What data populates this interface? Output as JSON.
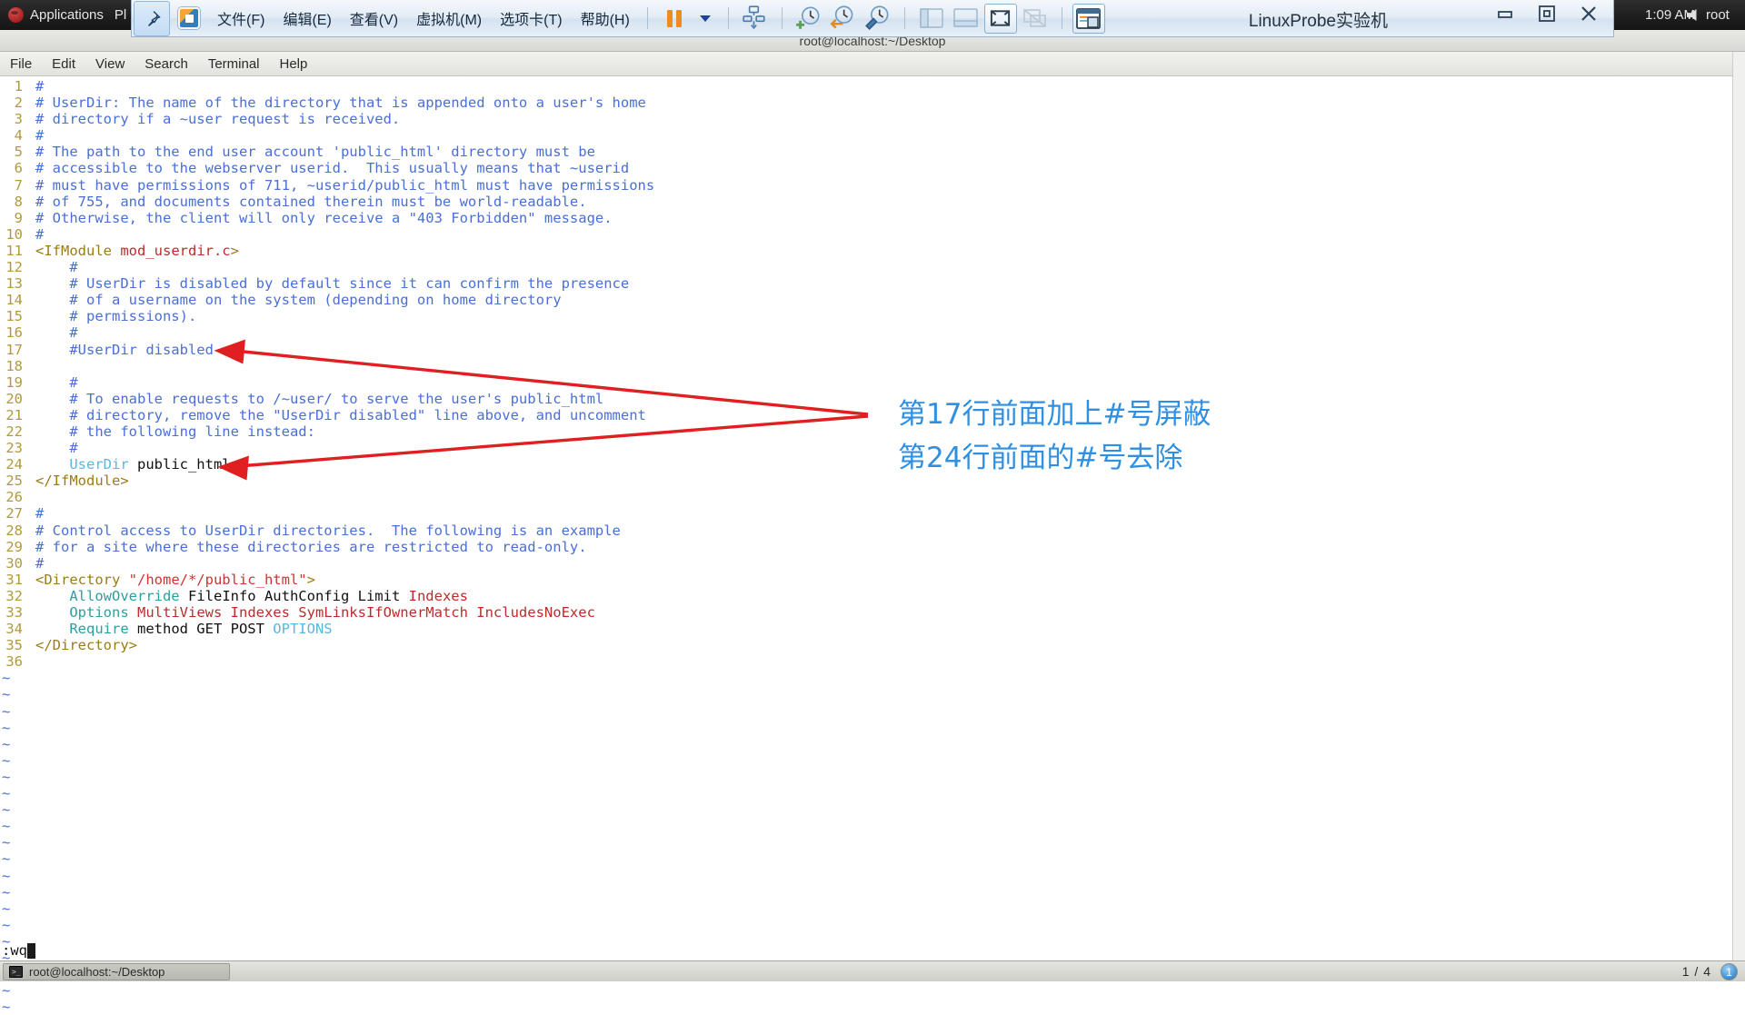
{
  "desktop_panel": {
    "applications_label": "Applications",
    "places_label": "Pl",
    "clock": "1:09 AM",
    "user": "root",
    "logo_icon": "fedora-logo-icon",
    "sound_icon": "speaker-icon"
  },
  "vmware": {
    "pin_icon": "pin-icon",
    "app_icon": "vmware-app-icon",
    "menus": [
      {
        "label": "文件(F)",
        "mnemonic": "F"
      },
      {
        "label": "编辑(E)",
        "mnemonic": "E"
      },
      {
        "label": "查看(V)",
        "mnemonic": "V"
      },
      {
        "label": "虚拟机(M)",
        "mnemonic": "M"
      },
      {
        "label": "选项卡(T)",
        "mnemonic": "T"
      },
      {
        "label": "帮助(H)",
        "mnemonic": "H"
      }
    ],
    "toolbar_icons": [
      "pause-icon",
      "power-dropdown-caret-icon",
      "snapshot-manager-icon",
      "take-snapshot-icon",
      "revert-snapshot-icon",
      "manage-snapshots-icon",
      "show-library-icon",
      "show-thumbnails-icon",
      "fullscreen-icon",
      "unity-mode-icon",
      "console-view-icon"
    ],
    "vm_title": "LinuxProbe实验机",
    "window_buttons": [
      "minimize-icon",
      "restore-icon",
      "close-icon"
    ]
  },
  "terminal": {
    "title": "root@localhost:~/Desktop",
    "menus": [
      "File",
      "Edit",
      "View",
      "Search",
      "Terminal",
      "Help"
    ]
  },
  "editor": {
    "command_line": ":wq",
    "cursor": "block-cursor",
    "tilde_count": 21,
    "lines": [
      {
        "n": 1,
        "spans": [
          {
            "t": "#",
            "c": "c-cmt"
          }
        ]
      },
      {
        "n": 2,
        "spans": [
          {
            "t": "# UserDir: The name of the directory that is appended onto a user's home",
            "c": "c-cmt"
          }
        ]
      },
      {
        "n": 3,
        "spans": [
          {
            "t": "# directory if a ~user request is received.",
            "c": "c-cmt"
          }
        ]
      },
      {
        "n": 4,
        "spans": [
          {
            "t": "#",
            "c": "c-cmt"
          }
        ]
      },
      {
        "n": 5,
        "spans": [
          {
            "t": "# The path to the end user account 'public_html' directory must be",
            "c": "c-cmt"
          }
        ]
      },
      {
        "n": 6,
        "spans": [
          {
            "t": "# accessible to the webserver userid.  This usually means that ~userid",
            "c": "c-cmt"
          }
        ]
      },
      {
        "n": 7,
        "spans": [
          {
            "t": "# must have permissions of 711, ~userid/public_html must have permissions",
            "c": "c-cmt"
          }
        ]
      },
      {
        "n": 8,
        "spans": [
          {
            "t": "# of 755, and documents contained therein must be world-readable.",
            "c": "c-cmt"
          }
        ]
      },
      {
        "n": 9,
        "spans": [
          {
            "t": "# Otherwise, the client will only receive a \"403 Forbidden\" message.",
            "c": "c-cmt"
          }
        ]
      },
      {
        "n": 10,
        "spans": [
          {
            "t": "#",
            "c": "c-cmt"
          }
        ]
      },
      {
        "n": 11,
        "spans": [
          {
            "t": "<IfModule ",
            "c": "c-tag"
          },
          {
            "t": "mod_userdir.c",
            "c": "c-id"
          },
          {
            "t": ">",
            "c": "c-tag"
          }
        ]
      },
      {
        "n": 12,
        "spans": [
          {
            "t": "    #",
            "c": "c-cmt"
          }
        ]
      },
      {
        "n": 13,
        "spans": [
          {
            "t": "    # UserDir is disabled by default since it can confirm the presence",
            "c": "c-cmt"
          }
        ]
      },
      {
        "n": 14,
        "spans": [
          {
            "t": "    # of a username on the system (depending on home directory",
            "c": "c-cmt"
          }
        ]
      },
      {
        "n": 15,
        "spans": [
          {
            "t": "    # permissions).",
            "c": "c-cmt"
          }
        ]
      },
      {
        "n": 16,
        "spans": [
          {
            "t": "    #",
            "c": "c-cmt"
          }
        ]
      },
      {
        "n": 17,
        "spans": [
          {
            "t": "    #UserDir disabled",
            "c": "c-cmt"
          }
        ]
      },
      {
        "n": 18,
        "spans": [
          {
            "t": "",
            "c": "c-plain"
          }
        ]
      },
      {
        "n": 19,
        "spans": [
          {
            "t": "    #",
            "c": "c-cmt"
          }
        ]
      },
      {
        "n": 20,
        "spans": [
          {
            "t": "    # To enable requests to /~user/ to serve the user's public_html",
            "c": "c-cmt"
          }
        ]
      },
      {
        "n": 21,
        "spans": [
          {
            "t": "    # directory, remove the \"UserDir disabled\" line above, and uncomment",
            "c": "c-cmt"
          }
        ]
      },
      {
        "n": 22,
        "spans": [
          {
            "t": "    # the following line instead:",
            "c": "c-cmt"
          }
        ]
      },
      {
        "n": 23,
        "spans": [
          {
            "t": "    #",
            "c": "c-cmt"
          }
        ]
      },
      {
        "n": 24,
        "spans": [
          {
            "t": "    ",
            "c": "c-plain"
          },
          {
            "t": "UserDir",
            "c": "c-val"
          },
          {
            "t": " public_html",
            "c": "c-plain"
          }
        ]
      },
      {
        "n": 25,
        "spans": [
          {
            "t": "</IfModule>",
            "c": "c-tag"
          }
        ]
      },
      {
        "n": 26,
        "spans": [
          {
            "t": "",
            "c": "c-plain"
          }
        ]
      },
      {
        "n": 27,
        "spans": [
          {
            "t": "#",
            "c": "c-cmt"
          }
        ]
      },
      {
        "n": 28,
        "spans": [
          {
            "t": "# Control access to UserDir directories.  The following is an example",
            "c": "c-cmt"
          }
        ]
      },
      {
        "n": 29,
        "spans": [
          {
            "t": "# for a site where these directories are restricted to read-only.",
            "c": "c-cmt"
          }
        ]
      },
      {
        "n": 30,
        "spans": [
          {
            "t": "#",
            "c": "c-cmt"
          }
        ]
      },
      {
        "n": 31,
        "spans": [
          {
            "t": "<Directory ",
            "c": "c-tag"
          },
          {
            "t": "\"/home/*/public_html\"",
            "c": "c-str"
          },
          {
            "t": ">",
            "c": "c-tag"
          }
        ]
      },
      {
        "n": 32,
        "spans": [
          {
            "t": "    ",
            "c": "c-plain"
          },
          {
            "t": "AllowOverride",
            "c": "c-key"
          },
          {
            "t": " FileInfo AuthConfig Limit ",
            "c": "c-plain"
          },
          {
            "t": "Indexes",
            "c": "c-id"
          }
        ]
      },
      {
        "n": 33,
        "spans": [
          {
            "t": "    ",
            "c": "c-plain"
          },
          {
            "t": "Options",
            "c": "c-key"
          },
          {
            "t": " ",
            "c": "c-plain"
          },
          {
            "t": "MultiViews Indexes SymLinksIfOwnerMatch IncludesNoExec",
            "c": "c-id"
          }
        ]
      },
      {
        "n": 34,
        "spans": [
          {
            "t": "    ",
            "c": "c-plain"
          },
          {
            "t": "Require",
            "c": "c-key"
          },
          {
            "t": " method GET POST ",
            "c": "c-plain"
          },
          {
            "t": "OPTIONS",
            "c": "c-val"
          }
        ]
      },
      {
        "n": 35,
        "spans": [
          {
            "t": "</Directory>",
            "c": "c-tag"
          }
        ]
      },
      {
        "n": 36,
        "spans": [
          {
            "t": "",
            "c": "c-plain"
          }
        ]
      }
    ]
  },
  "annotations": {
    "color": "#2f8fe0",
    "arrow_color": "#e02020",
    "line1": "第17行前面加上#号屏蔽",
    "line2": "第24行前面的#号去除"
  },
  "taskbar": {
    "window_title": "root@localhost:~/Desktop",
    "window_icon": "terminal-icon",
    "workspace_count": "1 / 4",
    "workspace_current": "1"
  }
}
